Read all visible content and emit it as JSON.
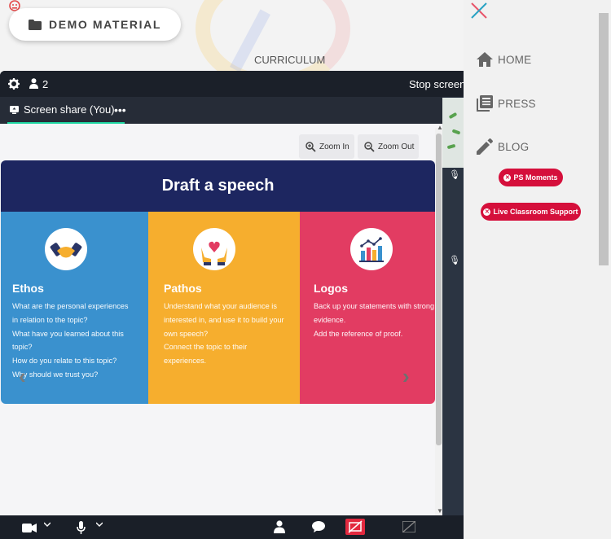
{
  "page": {
    "demo_material_label": "DEMO MATERIAL",
    "curriculum_label": "CURRICULUM"
  },
  "meeting": {
    "participant_count": "2",
    "stop_screen_label": "Stop screen",
    "tab_label": "Screen share (You)",
    "tab_more": "•••",
    "zoom_in_label": "Zoom In",
    "zoom_out_label": "Zoom Out"
  },
  "slide": {
    "title": "Draft a speech",
    "columns": [
      {
        "title": "Ethos",
        "color": "#3a91ce",
        "icon": "handshake-icon",
        "lines": [
          "What are the personal experiences",
          "in relation to the topic?",
          "What have you learned about this",
          "topic?",
          "How do you relate to this topic?",
          "Why should we trust you?"
        ]
      },
      {
        "title": "Pathos",
        "color": "#f6ae2e",
        "icon": "heart-in-hands-icon",
        "lines": [
          "Understand what your audience is",
          "interested in, and use it to build your",
          "own speech?",
          "Connect the topic to their",
          "experiences."
        ]
      },
      {
        "title": "Logos",
        "color": "#e23c62",
        "icon": "bar-chart-icon",
        "lines": [
          "Back up your statements with strong",
          "evidence.",
          "Add the reference of proof."
        ]
      }
    ],
    "header_color": "#1d2660"
  },
  "panel": {
    "nav": [
      {
        "label": "HOME",
        "icon": "home-icon"
      },
      {
        "label": "PRESS",
        "icon": "newspaper-icon"
      },
      {
        "label": "BLOG",
        "icon": "pencil-icon"
      }
    ],
    "ps_moments_label": "PS Moments",
    "live_support_label": "Live Classroom Support",
    "accent_color": "#d50f3b"
  }
}
